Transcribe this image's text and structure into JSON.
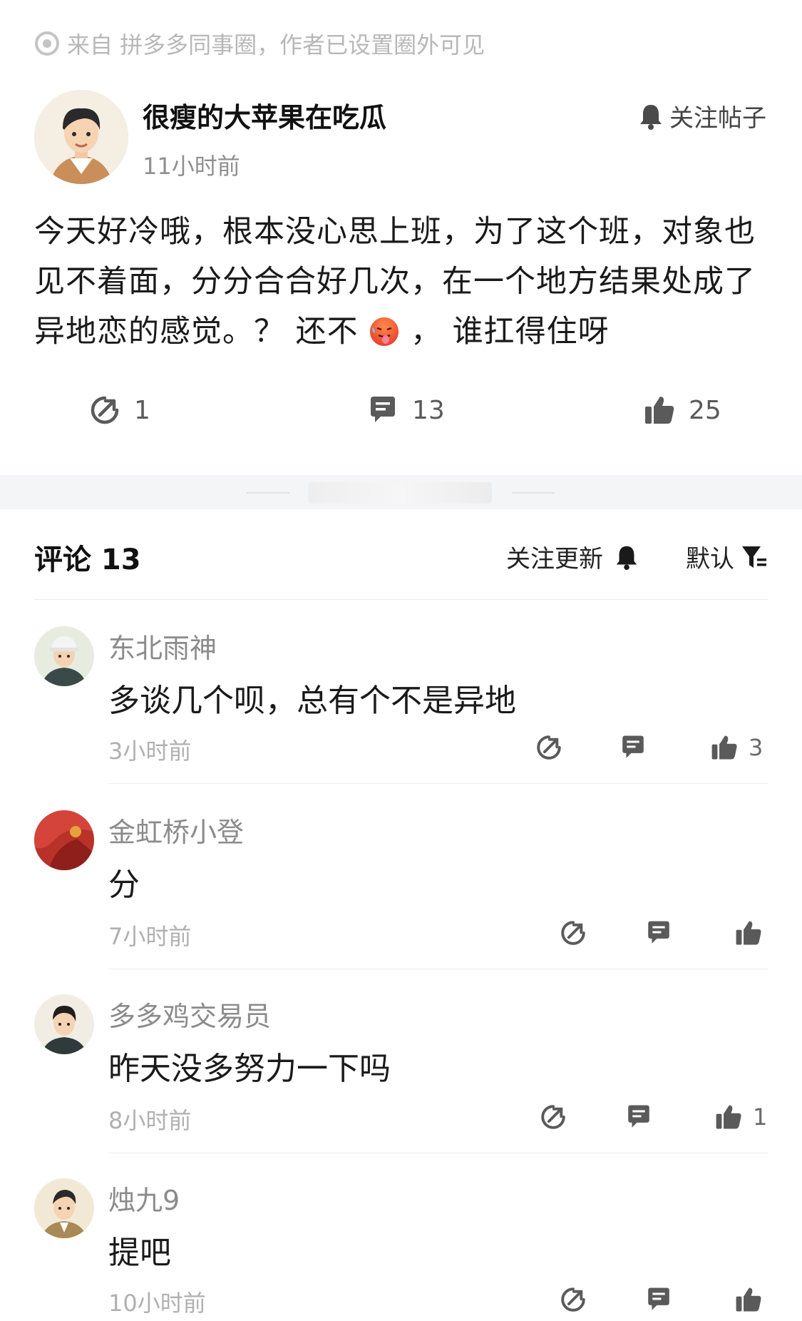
{
  "source": {
    "text": "来自 拼多多同事圈，作者已设置圈外可见",
    "icon": "record-icon"
  },
  "post": {
    "author": "很瘦的大苹果在吃瓜",
    "time": "11小时前",
    "follow_label": "关注帖子",
    "body_part1": "今天好冷哦，根本没心思上班，为了这个班，对象也见不着面，分分合合好几次，在一个地方结果处成了异地恋的感觉。？ 还不",
    "body_emoji": "hot-face-emoji",
    "body_part2": "， 谁扛得住呀",
    "shares": "1",
    "comments": "13",
    "likes": "25"
  },
  "comments_header": {
    "title": "评论 13",
    "follow_updates": "关注更新",
    "sort_label": "默认"
  },
  "comments": [
    {
      "name": "东北雨神",
      "text": "多谈几个呗，总有个不是异地",
      "time": "3小时前",
      "likes": "3"
    },
    {
      "name": "金虹桥小登",
      "text": "分",
      "time": "7小时前",
      "likes": ""
    },
    {
      "name": "多多鸡交易员",
      "text": "昨天没多努力一下吗",
      "time": "8小时前",
      "likes": "1"
    },
    {
      "name": "烛九9",
      "text": "提吧",
      "time": "10小时前",
      "likes": ""
    }
  ],
  "colors": {
    "text_primary": "#1a1a1a",
    "text_secondary": "#8f8f8f",
    "icon_gray": "#5a5a5a",
    "divider": "#ececec",
    "band": "#f4f5f7"
  }
}
